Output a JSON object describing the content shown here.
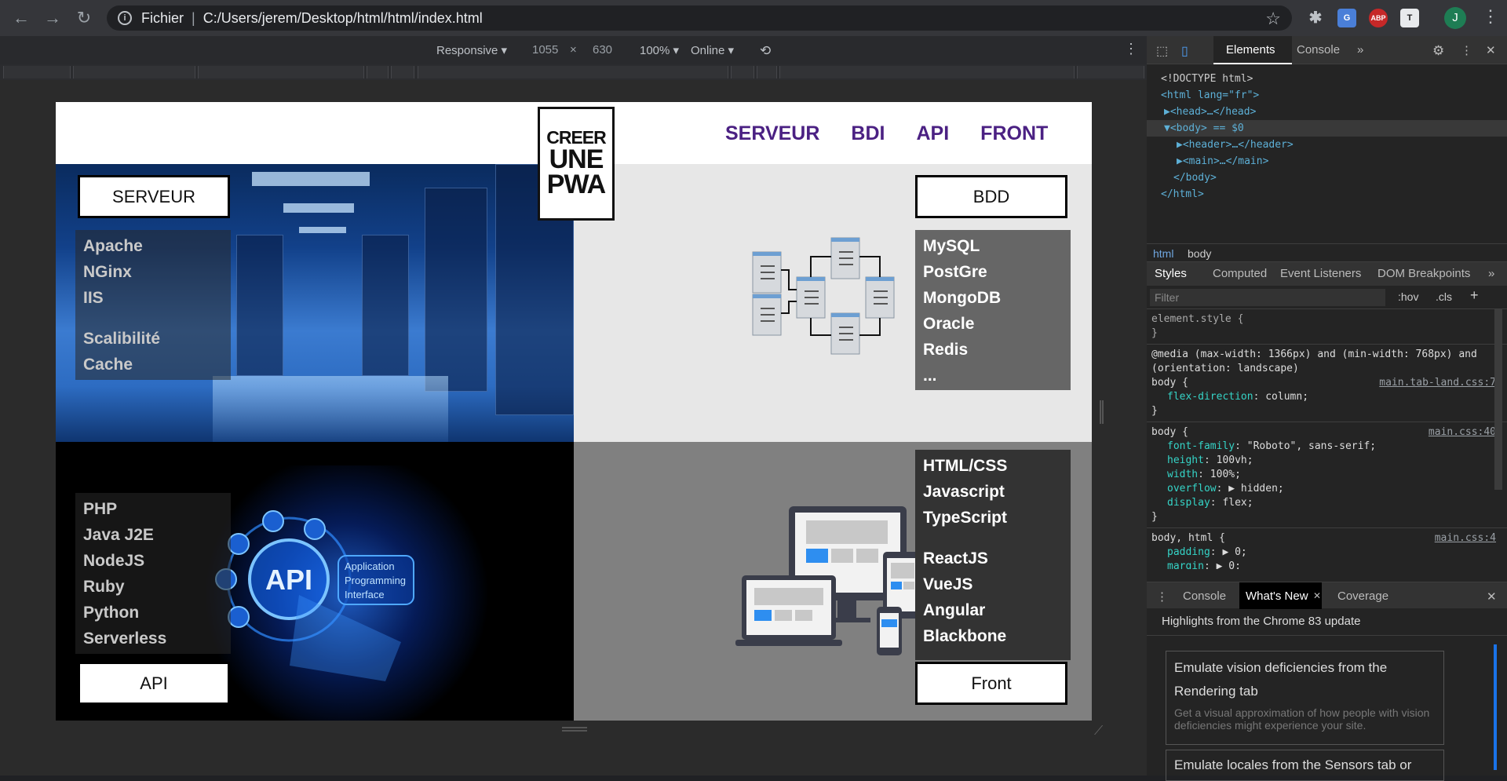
{
  "browser": {
    "scheme": "Fichier",
    "url": "C:/Users/jerem/Desktop/html/html/index.html",
    "avatar": "J",
    "extensions": [
      "settings-ext",
      "translate-ext",
      "adblock-ext",
      "t-ext"
    ],
    "abp_label": "ABP",
    "t_label": "T"
  },
  "device_toolbar": {
    "mode": "Responsive ▾",
    "width": "1055",
    "times": "×",
    "height": "630",
    "zoom": "100% ▾",
    "network": "Online ▾"
  },
  "site": {
    "logo": [
      "CREER",
      "UNE",
      "PWA"
    ],
    "nav": [
      "SERVEUR",
      "BDI",
      "API",
      "FRONT"
    ],
    "sections": {
      "serveur": {
        "label": "SERVEUR",
        "items": [
          "Apache",
          "NGinx",
          "IIS"
        ],
        "items2": [
          "Scalibilité",
          "Cache"
        ]
      },
      "bdd": {
        "label": "BDD",
        "items": [
          "MySQL",
          "PostGre",
          "MongoDB",
          "Oracle",
          "Redis",
          "..."
        ]
      },
      "api": {
        "label": "API",
        "items": [
          "PHP",
          "Java J2E",
          "NodeJS",
          "Ruby",
          "Python",
          "Serverless"
        ],
        "graphic_title": "API",
        "graphic_sub": [
          "Application",
          "Programming",
          "Interface"
        ]
      },
      "front": {
        "label": "Front",
        "items": [
          "HTML/CSS",
          "Javascript",
          "TypeScript"
        ],
        "items2": [
          "ReactJS",
          "VueJS",
          "Angular",
          "Blackbone"
        ]
      }
    }
  },
  "devtools": {
    "tabs": [
      "Elements",
      "Console",
      "»"
    ],
    "dom": [
      "<!DOCTYPE html>",
      "<html lang=\"fr\">",
      "▶<head>…</head>",
      "▼<body> == $0",
      "▶<header>…</header>",
      "▶<main>…</main>",
      "</body>",
      "</html>"
    ],
    "breadcrumbs": [
      "html",
      "body"
    ],
    "subtabs": [
      "Styles",
      "Computed",
      "Event Listeners",
      "DOM Breakpoints",
      "»"
    ],
    "filter_placeholder": "Filter",
    "filter_tools": [
      ":hov",
      ".cls",
      "+"
    ],
    "rules": [
      {
        "selector": "element.style {",
        "lines": [],
        "close": "}",
        "source": ""
      },
      {
        "selector": "@media (max-width: 1366px) and (min-width: 768px) and (orientation: landscape)",
        "sub": "body {",
        "lines": [
          [
            "flex-direction",
            "column;"
          ]
        ],
        "close": "}",
        "source": "main.tab-land.css:7"
      },
      {
        "selector": "body {",
        "lines": [
          [
            "font-family",
            "\"Roboto\", sans-serif;"
          ],
          [
            "height",
            "100vh;"
          ],
          [
            "width",
            "100%;"
          ],
          [
            "overflow",
            "▶ hidden;"
          ],
          [
            "display",
            "flex;"
          ]
        ],
        "close": "}",
        "source": "main.css:40"
      },
      {
        "selector": "body, html {",
        "lines": [
          [
            "padding",
            "▶ 0;"
          ],
          [
            "margin",
            "▶ 0;"
          ]
        ],
        "close": "",
        "source": "main.css:4"
      }
    ],
    "drawer_tabs": [
      "Console",
      "What's New",
      "Coverage"
    ],
    "whatsnew_heading": "Highlights from the Chrome 83 update",
    "cards": [
      {
        "title": "Emulate vision deficiencies from the Rendering tab",
        "desc": "Get a visual approximation of how people with vision deficiencies might experience your site."
      },
      {
        "title": "Emulate locales from the Sensors tab or",
        "desc": ""
      }
    ]
  }
}
